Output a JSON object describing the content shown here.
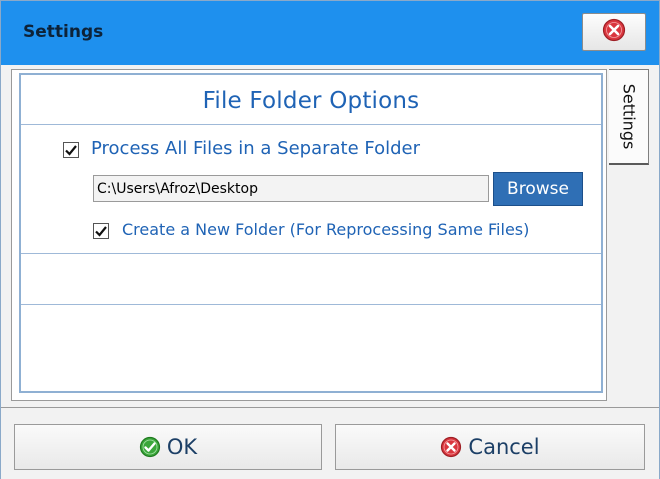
{
  "window": {
    "title": "Settings"
  },
  "panel": {
    "header": "File Folder Options",
    "process_all": {
      "label": "Process All Files in a Separate Folder",
      "checked": true
    },
    "folder_path": {
      "value": "C:\\Users\\Afroz\\Desktop"
    },
    "browse_label": "Browse",
    "create_new": {
      "label": "Create a New Folder (For Reprocessing Same Files)",
      "checked": true
    }
  },
  "side_tab": {
    "label": "Settings"
  },
  "footer": {
    "ok_label": "OK",
    "cancel_label": "Cancel"
  },
  "icons": {
    "close": "close-circle-icon",
    "ok": "check-circle-icon",
    "cancel": "cancel-circle-icon",
    "checkbox": "checkmark-icon"
  },
  "colors": {
    "titlebar": "#1e90ee",
    "accent_text": "#1f63b5",
    "browse_button": "#2f6fb5",
    "ok_green": "#3aa63a",
    "cancel_red": "#d9363e"
  }
}
